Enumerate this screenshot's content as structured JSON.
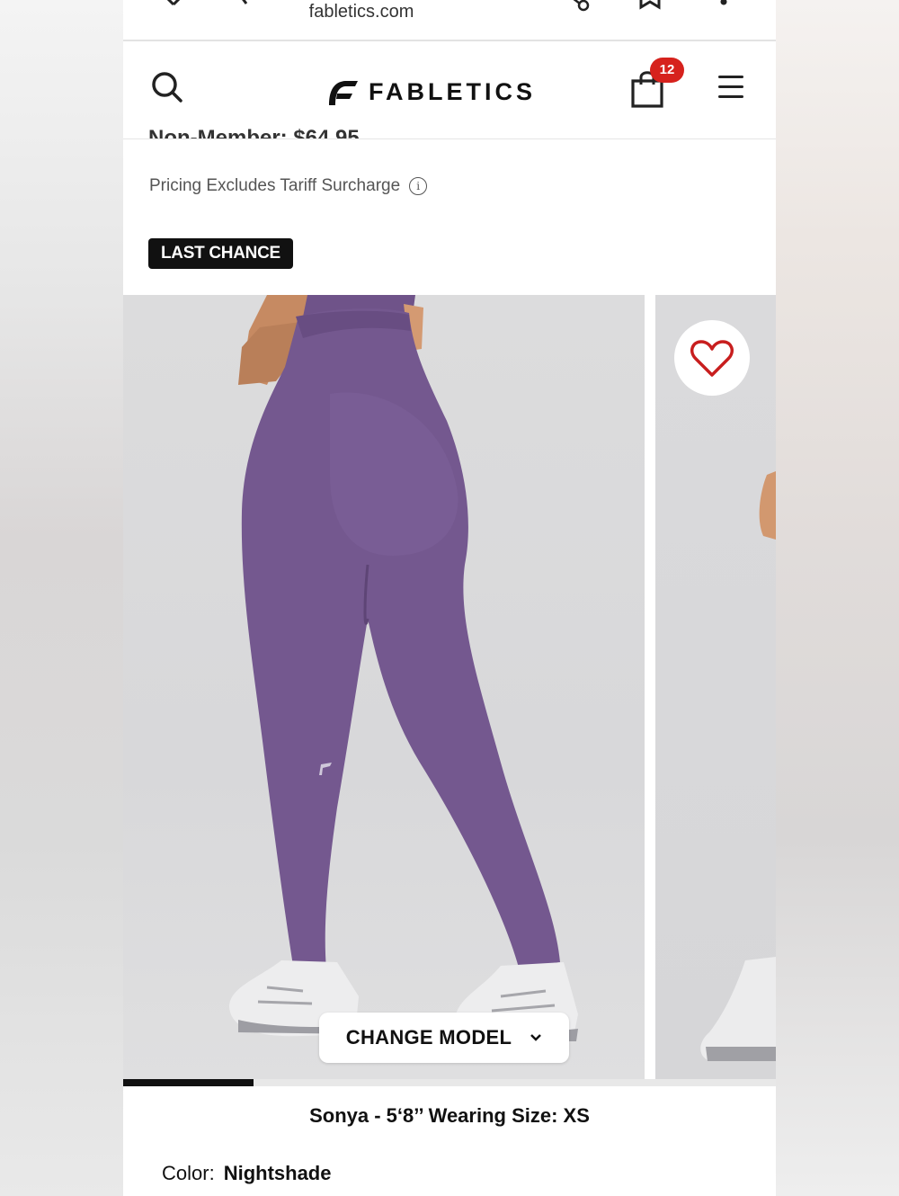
{
  "browser": {
    "url": "fabletics.com"
  },
  "header": {
    "brand": "FABLETICS",
    "cart_count": "12"
  },
  "product": {
    "member_price_cut": "Non-Member: $64.95",
    "tariff_note": "Pricing Excludes Tariff Surcharge",
    "badge": "LAST CHANCE",
    "gallery": {
      "change_model_label": "CHANGE MODEL",
      "progress": 0.2
    },
    "model_info": "Sonya - 5‘8’’ Wearing Size: XS",
    "color_label": "Color:",
    "color_value": "Nightshade"
  },
  "colors": {
    "accent_red": "#d6221d",
    "legging_purple": "#74588f",
    "badge_black": "#111111"
  },
  "icons": {
    "search": "search-icon",
    "cart": "shopping-bag-icon",
    "menu": "hamburger-menu-icon",
    "favorite": "heart-icon",
    "info": "info-icon",
    "dropdown": "chevron-down-icon"
  }
}
